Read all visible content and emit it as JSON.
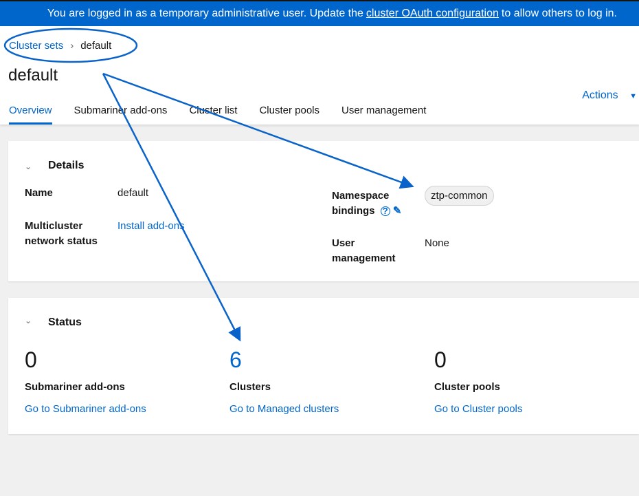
{
  "banner": {
    "text1": "You are logged in as a temporary administrative user. Update the",
    "link": "cluster OAuth configuration",
    "text2": "to allow others to log in."
  },
  "breadcrumb": {
    "parent": "Cluster sets",
    "current": "default"
  },
  "title": "default",
  "actions": "Actions",
  "tabs": [
    "Overview",
    "Submariner add-ons",
    "Cluster list",
    "Cluster pools",
    "User management"
  ],
  "details": {
    "heading": "Details",
    "name_label": "Name",
    "name_value": "default",
    "mc_label1": "Multicluster",
    "mc_label2": "network status",
    "mc_value": "Install add-ons",
    "ns_label1": "Namespace",
    "ns_label2": "bindings",
    "ns_value": "ztp-common",
    "um_label1": "User",
    "um_label2": "management",
    "um_value": "None"
  },
  "status": {
    "heading": "Status",
    "items": [
      {
        "count": "0",
        "label": "Submariner add-ons",
        "link": "Go to Submariner add-ons"
      },
      {
        "count": "6",
        "label": "Clusters",
        "link": "Go to Managed clusters"
      },
      {
        "count": "0",
        "label": "Cluster pools",
        "link": "Go to Cluster pools"
      }
    ]
  },
  "colors": {
    "accent": "#0066cc",
    "annotation": "#0a63c9"
  }
}
